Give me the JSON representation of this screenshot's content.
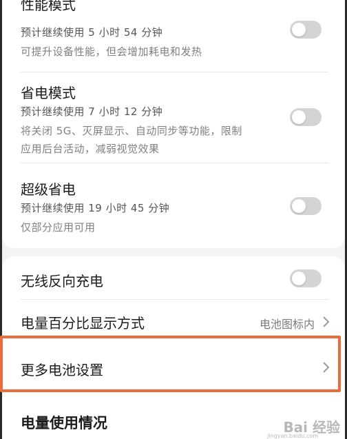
{
  "modes": [
    {
      "title": "性能模式",
      "estimate": "预计继续使用 5 小时 54 分钟",
      "description_lines": [
        "可提升设备性能，但会增加耗电和发热"
      ],
      "enabled": false
    },
    {
      "title": "省电模式",
      "estimate": "预计继续使用 7 小时 12 分钟",
      "description_lines": [
        "将关闭 5G、灭屏显示、自动同步等功能，限制",
        "应用后台活动，减弱视觉效果"
      ],
      "enabled": false
    },
    {
      "title": "超级省电",
      "estimate": "预计继续使用 19 小时 45 分钟",
      "description_lines": [
        "仅部分应用可用"
      ],
      "enabled": false
    }
  ],
  "settings": {
    "wireless_reverse": {
      "label": "无线反向充电",
      "enabled": false
    },
    "percentage_display": {
      "label": "电量百分比显示方式",
      "value": "电池图标内"
    },
    "more_battery": {
      "label": "更多电池设置"
    }
  },
  "usage_section": {
    "title": "电量使用情况"
  },
  "watermark": {
    "brand": "Bai 经验",
    "url": "jingyan.baidu.com"
  },
  "colors": {
    "highlight": "#ec6b3b",
    "toggle_off": "#d4d4d4"
  }
}
